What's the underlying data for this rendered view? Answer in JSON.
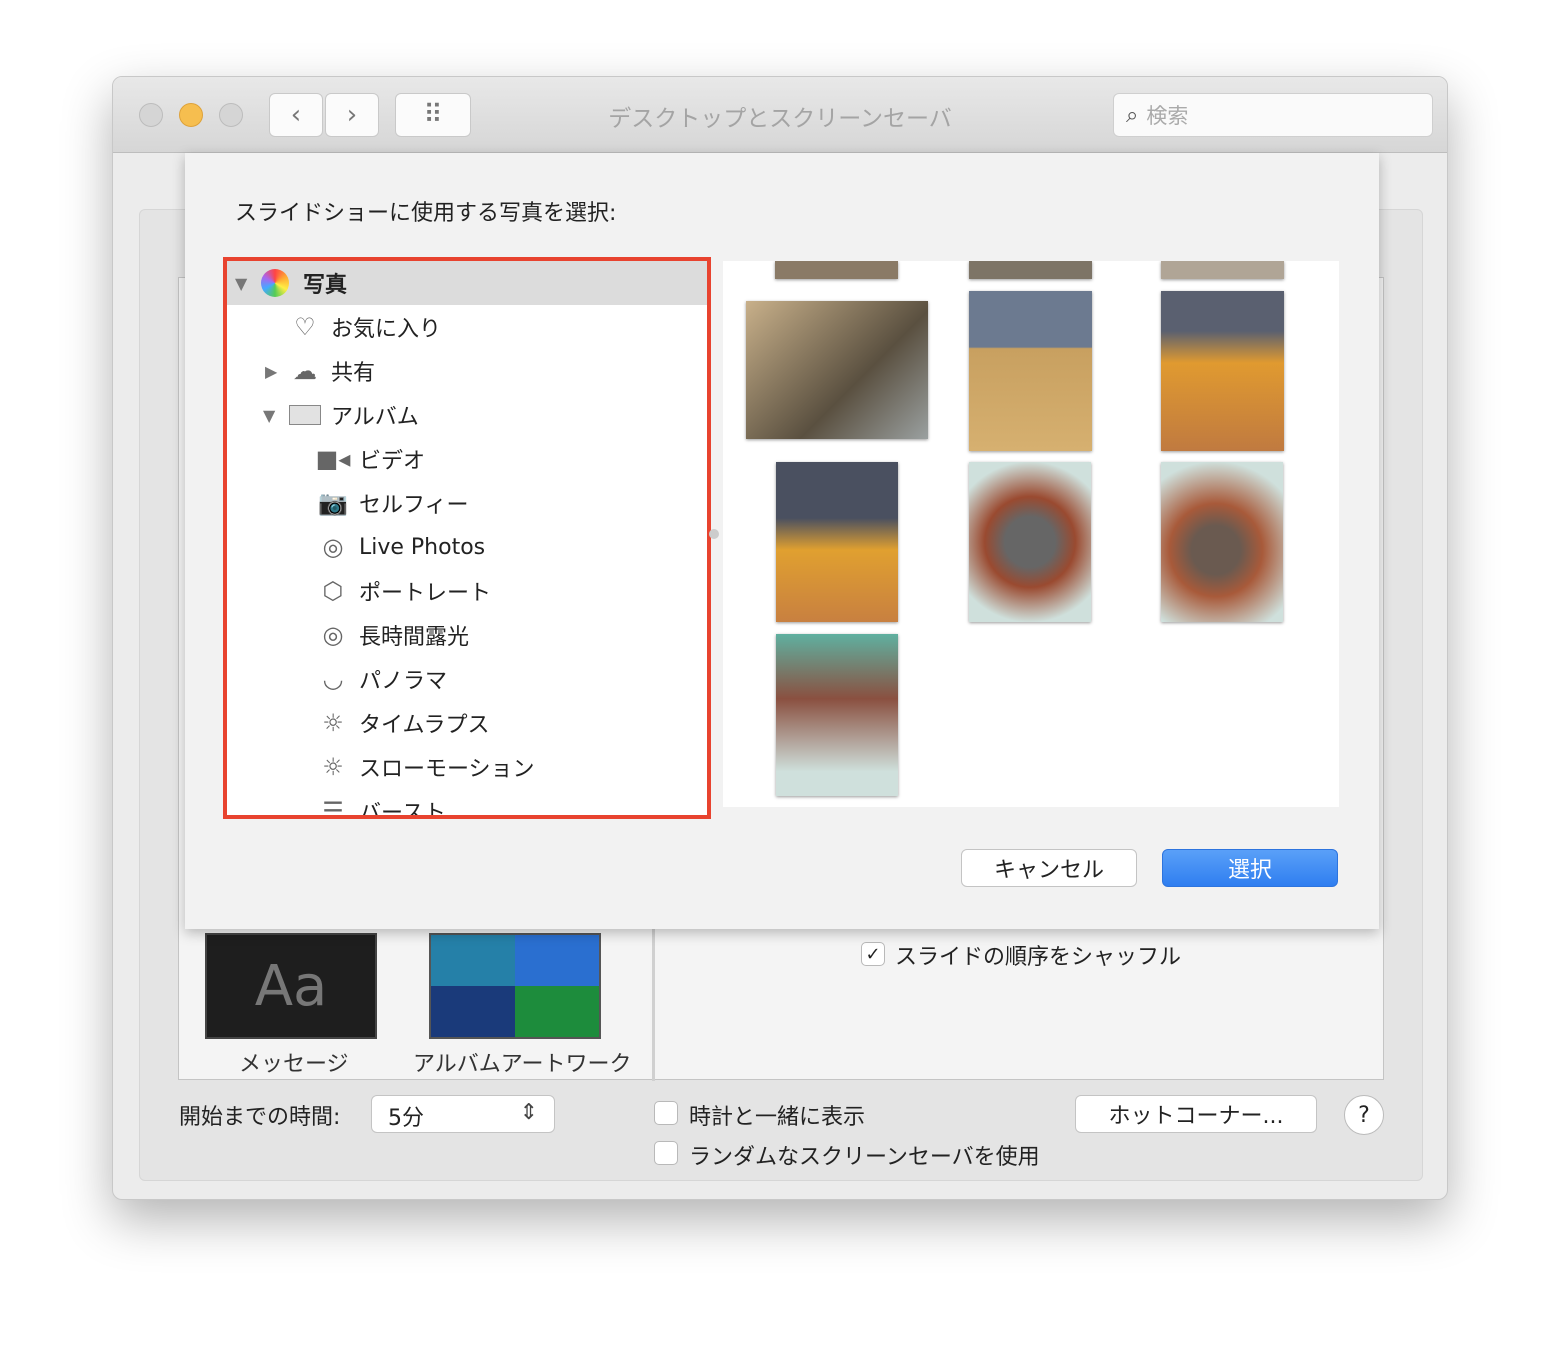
{
  "window": {
    "title": "デスクトップとスクリーンセーバ",
    "search_placeholder": "検索",
    "back": "‹",
    "forward": "›",
    "grid": "⠿"
  },
  "sheet": {
    "prompt": "スライドショーに使用する写真を選択:",
    "sources": [
      {
        "label": "写真",
        "icon": "photos-app-icon",
        "expanded": true,
        "selected": true
      },
      {
        "label": "お気に入り",
        "icon": "heart-icon"
      },
      {
        "label": "共有",
        "icon": "cloud-icon",
        "expanded": false
      },
      {
        "label": "アルバム",
        "icon": "folder-icon",
        "expanded": true
      },
      {
        "label": "ビデオ",
        "icon": "video-icon"
      },
      {
        "label": "セルフィー",
        "icon": "selfie-camera-icon"
      },
      {
        "label": "Live Photos",
        "icon": "live-photos-icon"
      },
      {
        "label": "ポートレート",
        "icon": "cube-icon"
      },
      {
        "label": "長時間露光",
        "icon": "long-exposure-icon"
      },
      {
        "label": "パノラマ",
        "icon": "panorama-icon"
      },
      {
        "label": "タイムラプス",
        "icon": "timelapse-icon"
      },
      {
        "label": "スローモーション",
        "icon": "slomo-icon"
      },
      {
        "label": "バースト",
        "icon": "burst-icon"
      }
    ],
    "cancel": "キャンセル",
    "select": "選択",
    "highlight_color": "#e8432f",
    "accent": "#2f7ef0"
  },
  "screensavers": [
    {
      "label": "メッセージ",
      "preview": "Aa"
    },
    {
      "label": "アルバムアートワーク"
    }
  ],
  "options": {
    "shuffle": "スライドの順序をシャッフル",
    "shuffle_checked": true
  },
  "bottom": {
    "start_label": "開始までの時間:",
    "start_value": "5分",
    "show_clock": "時計と一緒に表示",
    "show_clock_checked": false,
    "random": "ランダムなスクリーンセーバを使用",
    "random_checked": false,
    "hot_corners": "ホットコーナー...",
    "help": "?"
  }
}
